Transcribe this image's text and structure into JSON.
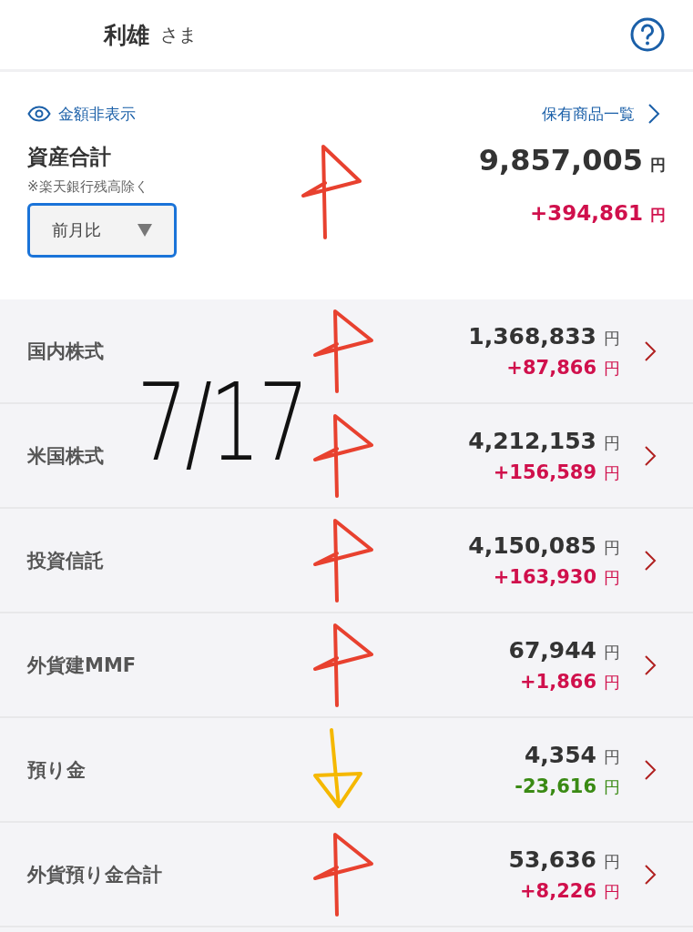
{
  "header": {
    "name": "利雄",
    "honorific": "さま"
  },
  "summary": {
    "hide_amounts": "金額非表示",
    "holdings_link": "保有商品一覧",
    "title": "資産合計",
    "note": "※楽天銀行残高除く",
    "period_select": "前月比",
    "total": "9,857,005",
    "total_unit": "円",
    "change": "+394,861",
    "change_unit": "円",
    "kind": "up",
    "color": "#e8412f"
  },
  "rows": [
    {
      "label": "国内株式",
      "value": "1,368,833",
      "value_unit": "円",
      "change": "+87,866",
      "change_unit": "円",
      "kind": "up",
      "color": "#e8412f"
    },
    {
      "label": "米国株式",
      "value": "4,212,153",
      "value_unit": "円",
      "change": "+156,589",
      "change_unit": "円",
      "kind": "up",
      "color": "#e8412f"
    },
    {
      "label": "投資信託",
      "value": "4,150,085",
      "value_unit": "円",
      "change": "+163,930",
      "change_unit": "円",
      "kind": "up",
      "color": "#e8412f"
    },
    {
      "label": "外貨建MMF",
      "value": "67,944",
      "value_unit": "円",
      "change": "+1,866",
      "change_unit": "円",
      "kind": "up",
      "color": "#e8412f"
    },
    {
      "label": "預り金",
      "value": "4,354",
      "value_unit": "円",
      "change": "-23,616",
      "change_unit": "円",
      "kind": "down",
      "color": "#f5b800"
    },
    {
      "label": "外貨預り金合計",
      "value": "53,636",
      "value_unit": "円",
      "change": "+8,226",
      "change_unit": "円",
      "kind": "up",
      "color": "#e8412f"
    }
  ],
  "handwritten_note": "7/17"
}
